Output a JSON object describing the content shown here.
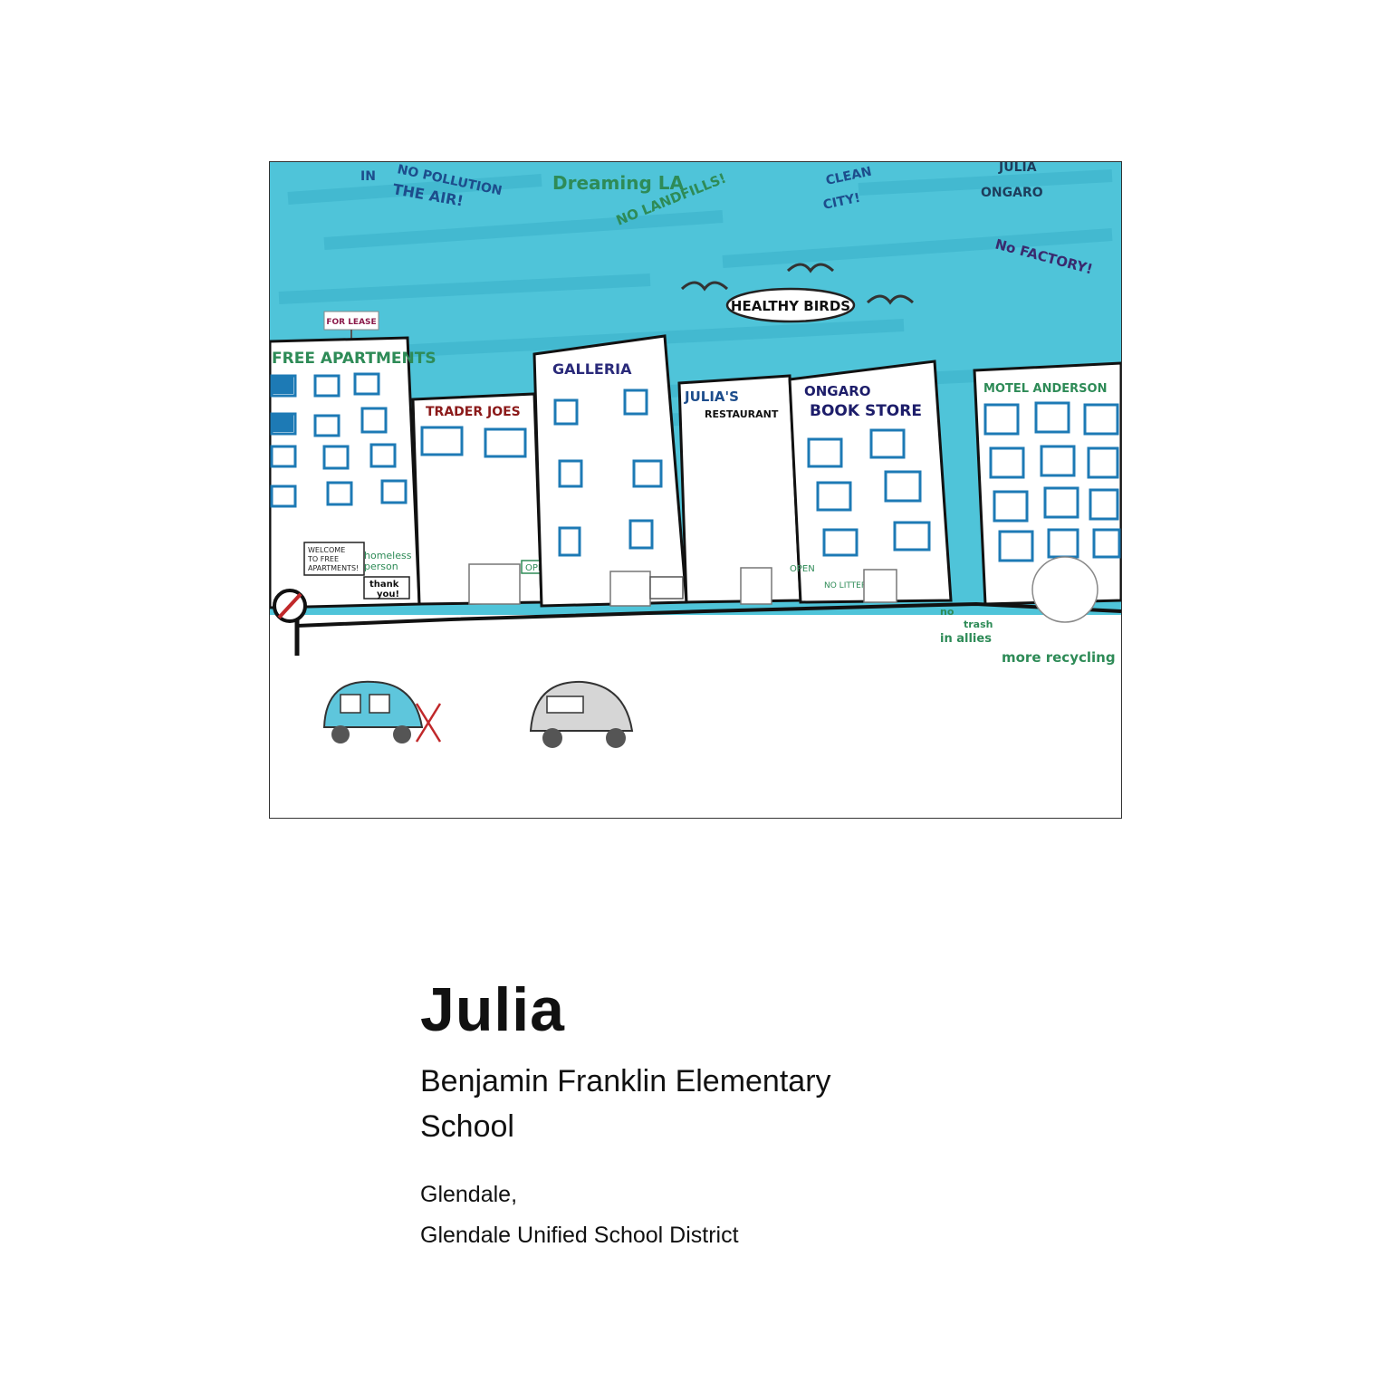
{
  "artwork": {
    "sky_color": "#4fc4d9",
    "sky_texts": {
      "no_pollution": "NO POLLUTION",
      "in": "IN",
      "the_air": "THE AIR!",
      "dreaming": "Dreaming LA",
      "no_landfills": "NO LANDFILLS!",
      "clean": "CLEAN",
      "city": "CITY!",
      "julia": "JULIA",
      "ongaro": "ONGARO",
      "no_factory": "No FACTORY!",
      "healthy_birds": "HEALTHY BIRDS"
    },
    "signs": {
      "for_lease": "FOR LEASE",
      "free_apartments": "FREE APARTMENTS",
      "trader_joes": "TRADER JOES",
      "galleria": "GALLERIA",
      "julias": "JULIA'S",
      "restaurant": "RESTAURANT",
      "ongaro": "ONGARO",
      "book_store": "BOOK STORE",
      "motel": "MOTEL ANDERSON",
      "welcome_1": "WELCOME",
      "welcome_2": "TO FREE",
      "welcome_3": "APARTMENTS!",
      "homeless_1": "homeless",
      "homeless_2": "person",
      "thank_you_1": "thank",
      "thank_you_2": "you!",
      "open_1": "OPEN",
      "open_2": "OPEN",
      "no_littering": "NO LITTERING",
      "no_trash_1": "no",
      "no_trash_2": "trash",
      "no_trash_3": "in allies",
      "more_recycling": "more recycling"
    }
  },
  "caption": {
    "name": "Julia",
    "school": "Benjamin Franklin Elementary School",
    "location_line1": "Glendale,",
    "location_line2": "Glendale Unified School District"
  }
}
